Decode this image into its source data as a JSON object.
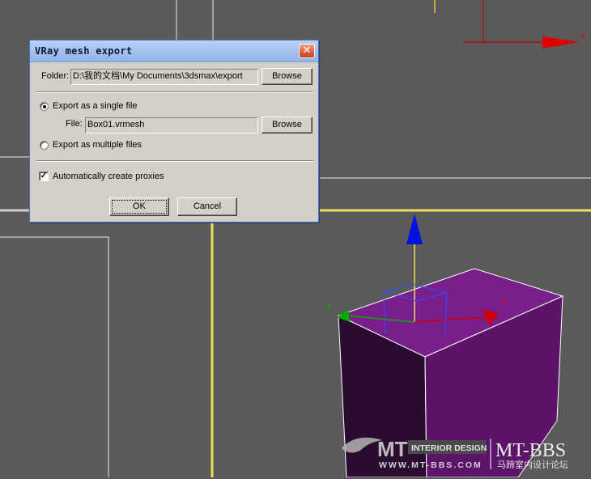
{
  "dialog": {
    "title": "VRay mesh export",
    "close_glyph": "✕",
    "folder_label": "Folder:",
    "folder_value": "D:\\我的文档\\My Documents\\3dsmax\\export",
    "browse_label": "Browse",
    "single_label": "Export as a single file",
    "file_label": "File:",
    "file_value": "Box01.vrmesh",
    "multiple_label": "Export as multiple files",
    "proxies_label": "Automatically create proxies",
    "export_mode": "single",
    "proxies_checked": true,
    "ok_label": "OK",
    "cancel_label": "Cancel"
  },
  "watermark": {
    "brand_left": "MT",
    "badge": "INTERIOR DESIGN",
    "brand_right": "MT-BBS",
    "url": "WWW.MT-BBS.COM",
    "chinese": "马蹄室内设计论坛"
  },
  "scene": {
    "viewport_bg": "#5a5a5a",
    "box_color": "#6e1a7a",
    "active_border": "#e8e05a",
    "gizmo_axis_x": "#cc0000",
    "gizmo_axis_y": "#00aa00",
    "gizmo_axis_z": "#0000dd"
  }
}
